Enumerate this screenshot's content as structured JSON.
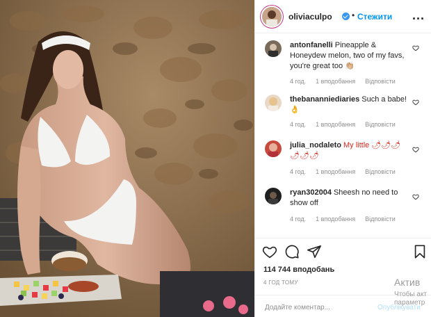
{
  "post": {
    "image_alt": "photo",
    "header": {
      "username": "oliviaculpo",
      "separator": "•",
      "follow_label": "Стежити",
      "more_label": "..."
    },
    "comments": [
      {
        "username": "antonfanelli",
        "text": "Pineapple & Honeydew melon, two of my favs, you're great too 👏🏼",
        "time": "4 год.",
        "likes": "1 вподобання",
        "reply": "Відповісти"
      },
      {
        "username": "thebananniediaries",
        "text": "Such a babe! 👌",
        "time": "4 год.",
        "likes": "1 вподобання",
        "reply": "Відповісти"
      },
      {
        "username": "julia_nodaleto",
        "text": "My little 🌶🌶🌶🌶🌶🌶",
        "time": "4 год.",
        "likes": "1 вподобання",
        "reply": "Відповісти"
      },
      {
        "username": "ryan302004",
        "text": "Sheesh no need to show off",
        "time": "4 год.",
        "likes": "1 вподобання",
        "reply": "Відповісти"
      }
    ],
    "likes_count": "114 744 вподобань",
    "time_ago": "4 ГОД ТОМУ",
    "add_comment": {
      "placeholder": "Додайте коментар...",
      "publish_label": "Опублікувати"
    },
    "icons": [
      "heart-icon",
      "comment-icon",
      "share-icon",
      "bookmark-icon",
      "verified-badge-icon",
      "small-heart-icon"
    ],
    "colors": {
      "follow": "#0095f6",
      "verified": "#3897f0",
      "muted": "#8e8e8e",
      "chili": "#d62b1f"
    }
  },
  "os_watermark": {
    "line1": "Актив",
    "line2": "Чтобы акт",
    "line3": "параметр"
  }
}
